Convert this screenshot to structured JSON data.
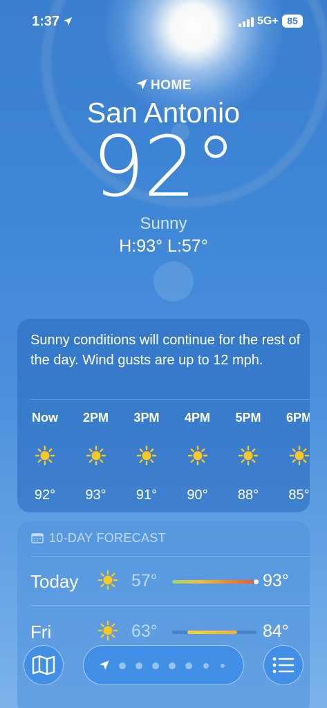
{
  "status_bar": {
    "time": "1:37",
    "network": "5G+",
    "battery": "85"
  },
  "location": {
    "label": "HOME",
    "city": "San Antonio",
    "temperature": "92°",
    "condition": "Sunny",
    "high_low": "H:93°  L:57°"
  },
  "hourly": {
    "summary": "Sunny conditions will continue for the rest of the day. Wind gusts are up to 12 mph.",
    "hours": [
      {
        "time": "Now",
        "icon": "sun-icon",
        "temp": "92°"
      },
      {
        "time": "2PM",
        "icon": "sun-icon",
        "temp": "93°"
      },
      {
        "time": "3PM",
        "icon": "sun-icon",
        "temp": "91°"
      },
      {
        "time": "4PM",
        "icon": "sun-icon",
        "temp": "90°"
      },
      {
        "time": "5PM",
        "icon": "sun-icon",
        "temp": "88°"
      },
      {
        "time": "6PM",
        "icon": "sun-icon",
        "temp": "85°"
      }
    ]
  },
  "forecast": {
    "title": "10-DAY FORECAST",
    "days": [
      {
        "day": "Today",
        "icon": "sun-icon",
        "low": "57°",
        "high": "93°"
      },
      {
        "day": "Fri",
        "icon": "sun-icon",
        "low": "63°",
        "high": "84°"
      }
    ]
  },
  "toolbar": {
    "map_icon": "map-icon",
    "list_icon": "list-icon"
  },
  "colors": {
    "sun": "#f7c826",
    "accent_blue": "#3d82d3"
  }
}
